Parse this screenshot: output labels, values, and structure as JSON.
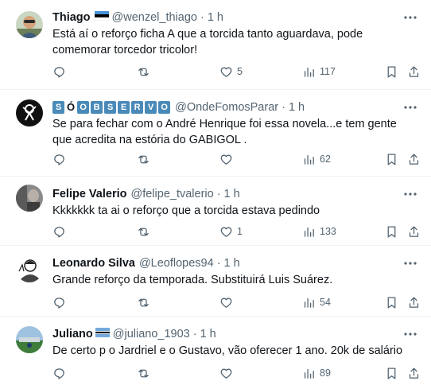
{
  "tweets": [
    {
      "name": "Thiago",
      "handle": "@wenzel_thiago",
      "time": "1 h",
      "text": "Está aí o reforço ficha A que a torcida tanto aguardava, pode comemorar torcedor tricolor!",
      "replies": "",
      "retweets": "",
      "likes": "5",
      "views": "117",
      "flag": "estonia-flag"
    },
    {
      "name_letters": [
        "S",
        "Ó",
        "O",
        "B",
        "S",
        "E",
        "R",
        "V",
        "O"
      ],
      "handle": "@OndeFomosParar",
      "time": "1 h",
      "text": "Se para fechar com o André Henrique foi essa novela...e tem gente que acredita na estória do GABIGOL .",
      "replies": "",
      "retweets": "",
      "likes": "",
      "views": "62"
    },
    {
      "name": "Felipe Valerio",
      "handle": "@felipe_tvalerio",
      "time": "1 h",
      "text": "Kkkkkkk ta ai o reforço que a torcida estava pedindo",
      "replies": "",
      "retweets": "",
      "likes": "1",
      "views": "133"
    },
    {
      "name": "Leonardo Silva",
      "handle": "@Leoflopes94",
      "time": "1 h",
      "text": "Grande reforço da temporada. Substituirá Luis Suárez.",
      "replies": "",
      "retweets": "",
      "likes": "",
      "views": "54"
    },
    {
      "name": "Juliano",
      "handle": "@juliano_1903",
      "time": "1 h",
      "text": "De certo p o Jardriel e o Gustavo, vão oferecer 1 ano. 20k de salário",
      "replies": "",
      "retweets": "",
      "likes": "",
      "views": "89",
      "flag": "botswana-flag"
    }
  ],
  "separator": "·",
  "colors": {
    "text": "#0f1419",
    "secondary": "#536471",
    "border": "#eff3f4",
    "observo_tile": "#4a8ab8"
  }
}
